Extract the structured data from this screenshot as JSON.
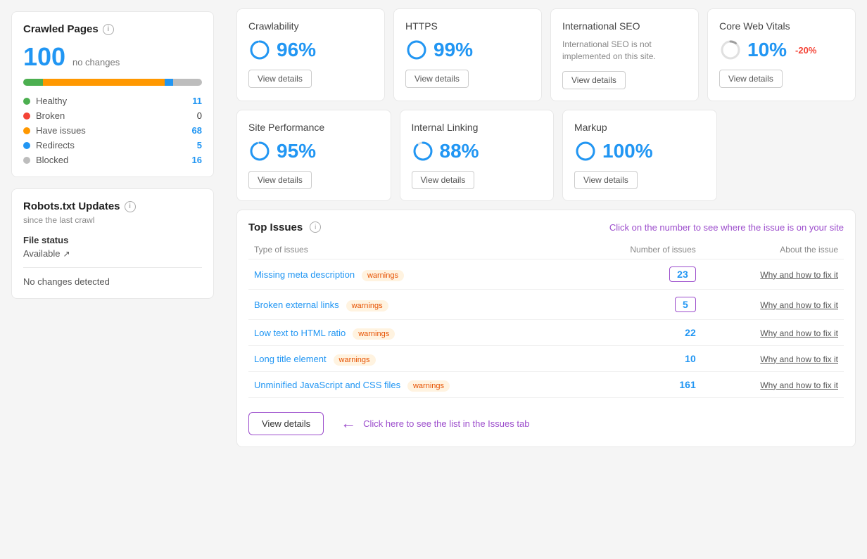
{
  "sidebar": {
    "crawled": {
      "title": "Crawled Pages",
      "count": "100",
      "count_suffix": "no changes",
      "legend": [
        {
          "label": "Healthy",
          "value": "11",
          "dot": "green",
          "zero": false
        },
        {
          "label": "Broken",
          "value": "0",
          "dot": "red",
          "zero": true
        },
        {
          "label": "Have issues",
          "value": "68",
          "dot": "orange",
          "zero": false
        },
        {
          "label": "Redirects",
          "value": "5",
          "dot": "blue",
          "zero": false
        },
        {
          "label": "Blocked",
          "value": "16",
          "dot": "gray",
          "zero": false
        }
      ]
    },
    "robots": {
      "title": "Robots.txt Updates",
      "since_label": "since the last crawl",
      "file_status_label": "File status",
      "file_available": "Available",
      "no_changes": "No changes detected"
    }
  },
  "metrics": [
    {
      "title": "Crawlability",
      "percent": "96%",
      "change": "",
      "desc": "",
      "btn": "View details"
    },
    {
      "title": "HTTPS",
      "percent": "99%",
      "change": "",
      "desc": "",
      "btn": "View details"
    },
    {
      "title": "International SEO",
      "percent": "",
      "change": "",
      "desc": "International SEO is not implemented on this site.",
      "btn": "View details"
    },
    {
      "title": "Core Web Vitals",
      "percent": "10%",
      "change": "-20%",
      "desc": "",
      "btn": "View details"
    }
  ],
  "metrics2": [
    {
      "title": "Site Performance",
      "percent": "95%",
      "change": "",
      "desc": "",
      "btn": "View details"
    },
    {
      "title": "Internal Linking",
      "percent": "88%",
      "change": "",
      "desc": "",
      "btn": "View details"
    },
    {
      "title": "Markup",
      "percent": "100%",
      "change": "",
      "desc": "",
      "btn": "View details"
    }
  ],
  "top_issues": {
    "title": "Top Issues",
    "hint": "Click on the number to see where the issue is on your site",
    "col_type": "Type of issues",
    "col_number": "Number of issues",
    "col_about": "About the issue",
    "issues": [
      {
        "name": "Missing meta description",
        "badge": "warnings",
        "count": "23",
        "boxed": true,
        "why": "Why and how to fix it"
      },
      {
        "name": "Broken external links",
        "badge": "warnings",
        "count": "5",
        "boxed": true,
        "why": "Why and how to fix it"
      },
      {
        "name": "Low text to HTML ratio",
        "badge": "warnings",
        "count": "22",
        "boxed": false,
        "why": "Why and how to fix it"
      },
      {
        "name": "Long title element",
        "badge": "warnings",
        "count": "10",
        "boxed": false,
        "why": "Why and how to fix it"
      },
      {
        "name": "Unminified JavaScript and CSS files",
        "badge": "warnings",
        "count": "161",
        "boxed": false,
        "why": "Why and how to fix it"
      }
    ],
    "view_details_btn": "View details",
    "click_hint": "Click here to see the list in the Issues tab"
  }
}
